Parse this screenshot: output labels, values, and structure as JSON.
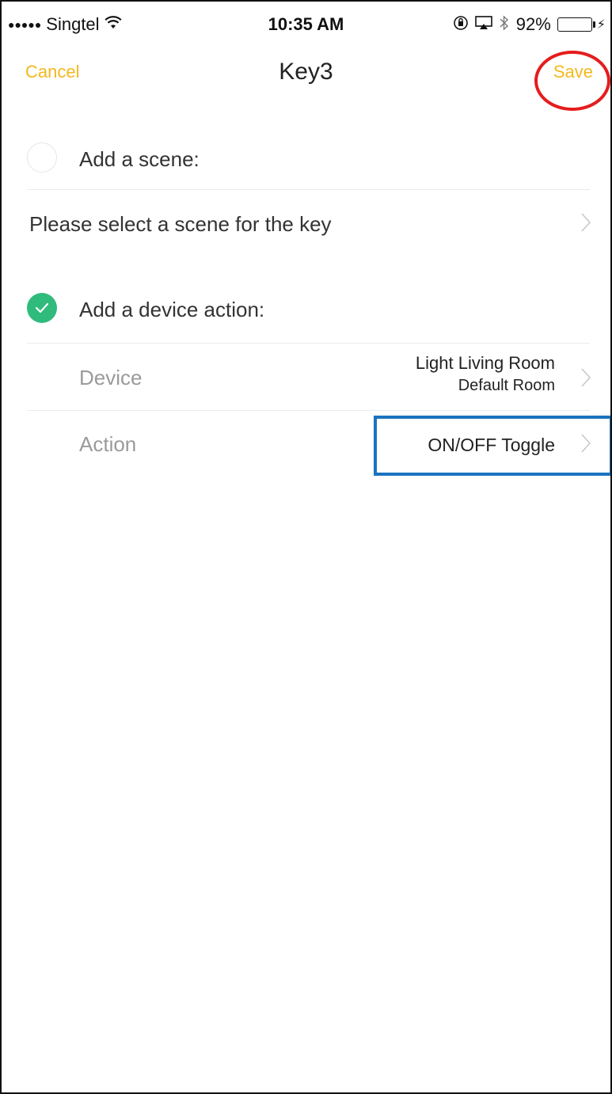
{
  "status_bar": {
    "carrier": "Singtel",
    "signal_dots": "●●●●●",
    "wifi_icon": "wifi-icon",
    "time": "10:35 AM",
    "battery_percent": "92%",
    "battery_level": 0.92,
    "battery_color": "#4cd964"
  },
  "nav": {
    "cancel_label": "Cancel",
    "title": "Key3",
    "save_label": "Save",
    "accent_color": "#f3b81d"
  },
  "scene_section": {
    "label": "Add a scene:",
    "selected": false,
    "select_prompt": "Please select a scene for the key"
  },
  "device_section": {
    "label": "Add a device action:",
    "selected": true,
    "check_color": "#2fbb7c",
    "device_label": "Device",
    "device_name": "Light Living Room",
    "device_room": "Default Room",
    "action_label": "Action",
    "action_value": "ON/OFF Toggle"
  },
  "annotations": {
    "save_circle_color": "#e51c1c",
    "action_box_color": "#1a73c0"
  }
}
